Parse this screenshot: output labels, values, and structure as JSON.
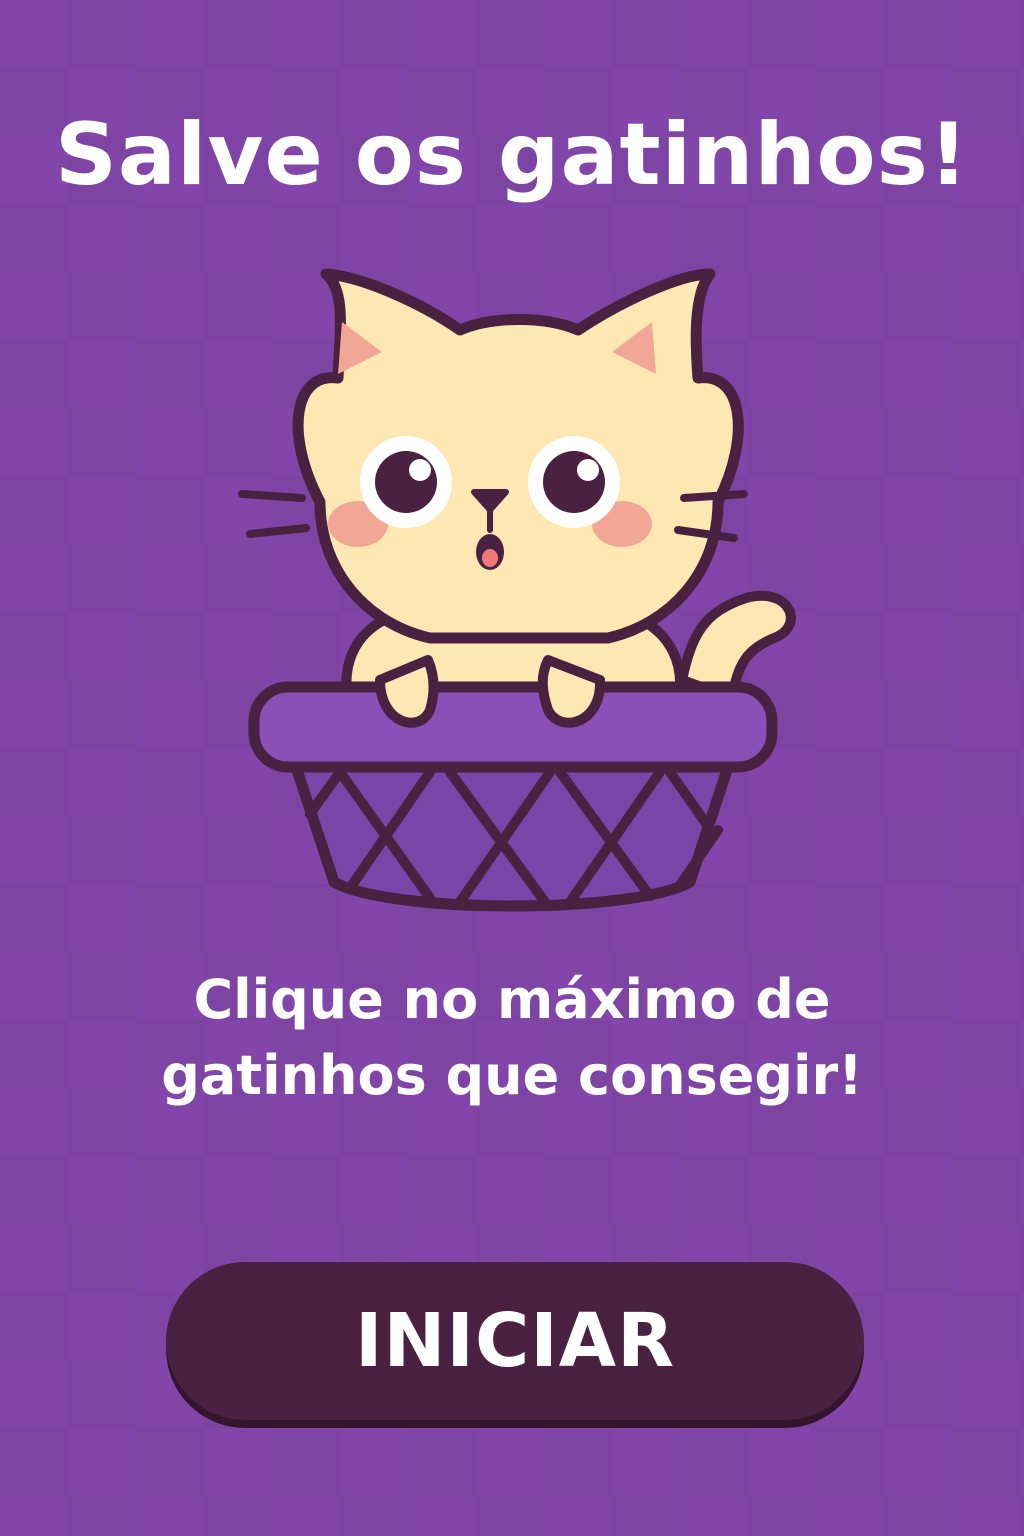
{
  "screen": {
    "title": "Salve os gatinhos!",
    "instructions": "Clique no máximo de gatinhos que consegir!",
    "start_label": "INICIAR"
  },
  "mascot": {
    "icon": "cat-in-basket-icon"
  },
  "colors": {
    "background": "#8246aa",
    "text": "#ffffff",
    "button": "#4a2140",
    "cat_fur": "#fde8b4",
    "outline": "#4a2140",
    "basket": "#8b4fb8"
  }
}
